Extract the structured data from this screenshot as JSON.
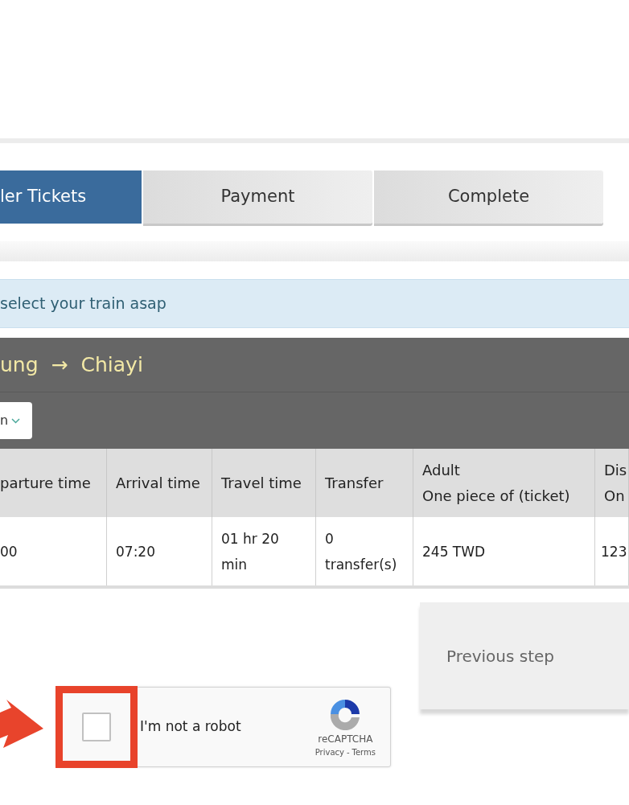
{
  "steps": [
    {
      "label": "ler Tickets",
      "selected": true
    },
    {
      "label": "Payment",
      "selected": false
    },
    {
      "label": "Complete",
      "selected": false
    }
  ],
  "notice": "select your train asap",
  "route": {
    "from": "ung",
    "arrow": "→",
    "to": "Chiayi"
  },
  "filter": {
    "value": "n"
  },
  "table": {
    "columns": [
      {
        "title": "parture time"
      },
      {
        "title": "Arrival time"
      },
      {
        "title": "Travel time"
      },
      {
        "title": "Transfer"
      },
      {
        "title": "Adult",
        "subtitle": "One piece of (ticket)"
      },
      {
        "title": "Dis",
        "subtitle": "On"
      }
    ],
    "rows": [
      [
        "00",
        "07:20",
        "01 hr 20 min",
        "0 transfer(s)",
        "245 TWD",
        "123"
      ]
    ]
  },
  "previous_button": "Previous step",
  "captcha": {
    "label": "I'm not a robot",
    "checked": false,
    "brand": "reCAPTCHA",
    "privacy": "Privacy",
    "separator": "-",
    "terms": "Terms"
  }
}
